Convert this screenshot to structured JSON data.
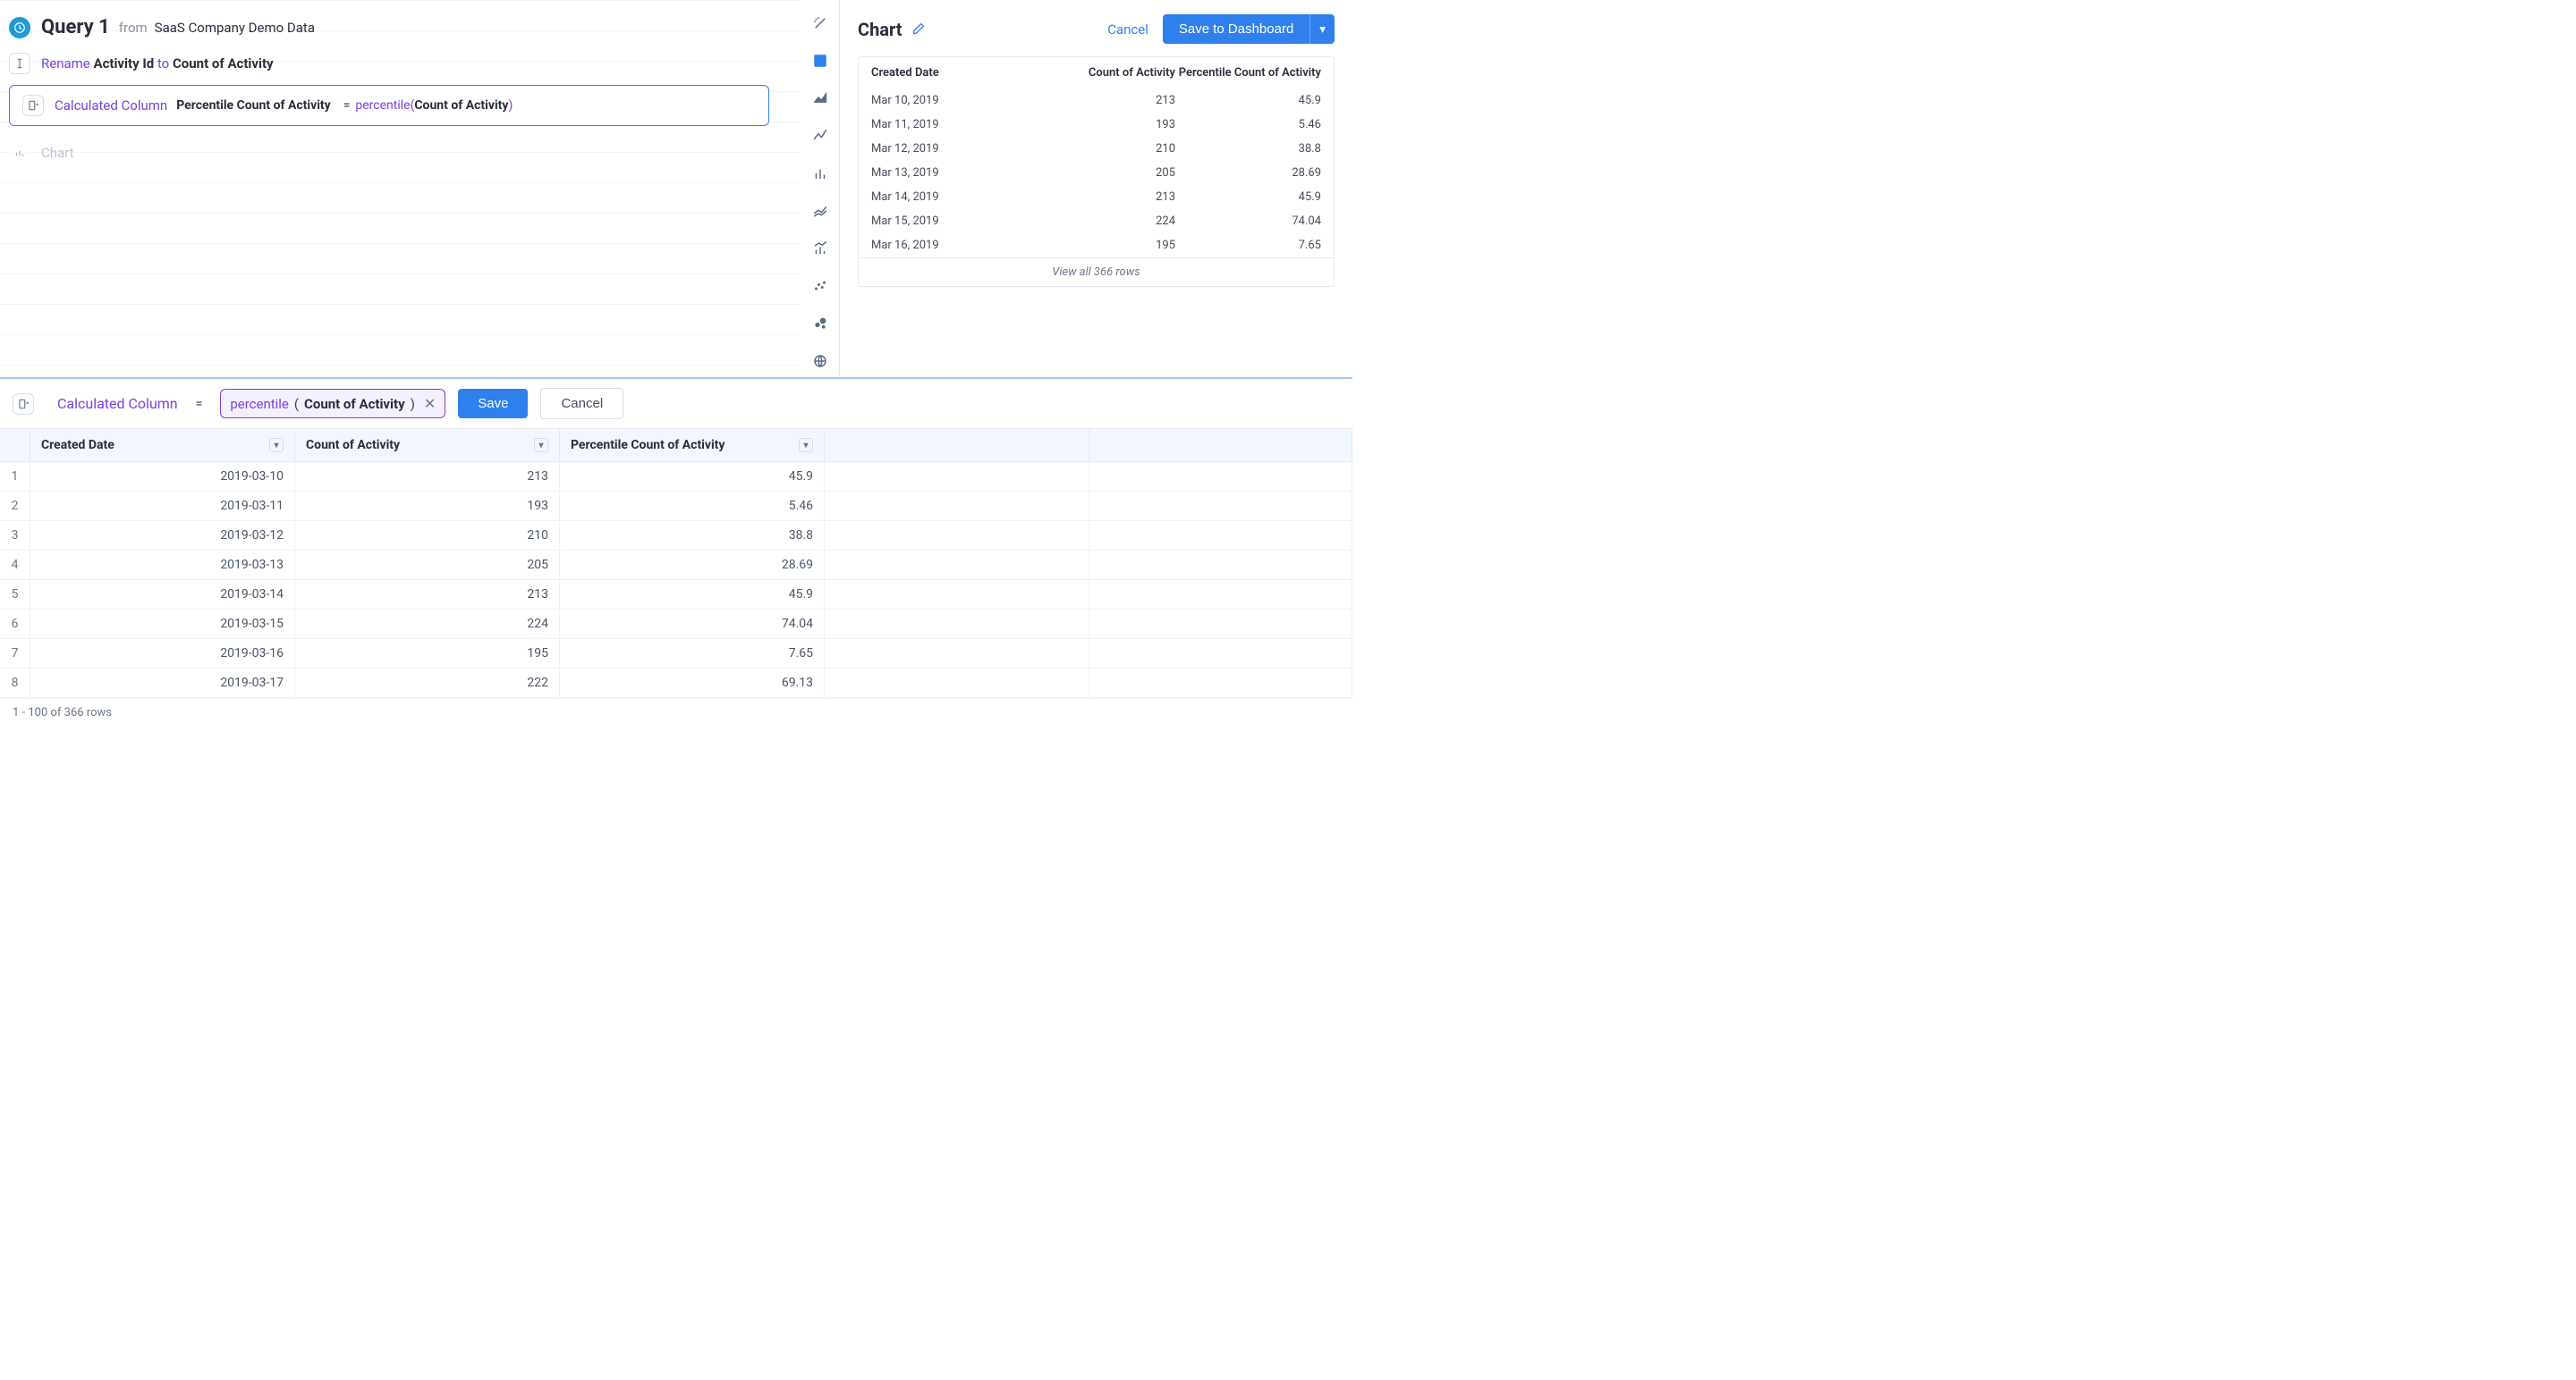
{
  "query": {
    "title": "Query 1",
    "from_label": "from",
    "source": "SaaS Company Demo Data"
  },
  "steps": {
    "rename": {
      "prefix": "Rename",
      "old": "Activity Id",
      "to": "to",
      "new": "Count of Activity"
    },
    "calc": {
      "label": "Calculated Column",
      "column": "Percentile Count of Activity",
      "equals": "=",
      "fn": "percentile",
      "arg": "Count of Activity"
    },
    "chart_placeholder": "Chart"
  },
  "chart_panel": {
    "title": "Chart",
    "cancel": "Cancel",
    "save": "Save to Dashboard",
    "preview_headers": {
      "c1": "Created Date",
      "c2": "Count of Activity",
      "c3": "Percentile Count of Activity"
    },
    "view_all": "View all 366 rows",
    "rows": [
      {
        "date": "Mar 10, 2019",
        "count": "213",
        "pct": "45.9"
      },
      {
        "date": "Mar 11, 2019",
        "count": "193",
        "pct": "5.46"
      },
      {
        "date": "Mar 12, 2019",
        "count": "210",
        "pct": "38.8"
      },
      {
        "date": "Mar 13, 2019",
        "count": "205",
        "pct": "28.69"
      },
      {
        "date": "Mar 14, 2019",
        "count": "213",
        "pct": "45.9"
      },
      {
        "date": "Mar 15, 2019",
        "count": "224",
        "pct": "74.04"
      },
      {
        "date": "Mar 16, 2019",
        "count": "195",
        "pct": "7.65"
      }
    ]
  },
  "editor": {
    "label": "Calculated Column",
    "equals": "=",
    "fn": "percentile",
    "arg": "Count of Activity",
    "save": "Save",
    "cancel": "Cancel"
  },
  "table": {
    "headers": {
      "c1": "Created Date",
      "c2": "Count of Activity",
      "c3": "Percentile Count of Activity"
    },
    "rows": [
      {
        "i": "1",
        "date": "2019-03-10",
        "count": "213",
        "pct": "45.9"
      },
      {
        "i": "2",
        "date": "2019-03-11",
        "count": "193",
        "pct": "5.46"
      },
      {
        "i": "3",
        "date": "2019-03-12",
        "count": "210",
        "pct": "38.8"
      },
      {
        "i": "4",
        "date": "2019-03-13",
        "count": "205",
        "pct": "28.69"
      },
      {
        "i": "5",
        "date": "2019-03-14",
        "count": "213",
        "pct": "45.9"
      },
      {
        "i": "6",
        "date": "2019-03-15",
        "count": "224",
        "pct": "74.04"
      },
      {
        "i": "7",
        "date": "2019-03-16",
        "count": "195",
        "pct": "7.65"
      },
      {
        "i": "8",
        "date": "2019-03-17",
        "count": "222",
        "pct": "69.13"
      }
    ],
    "footer": "1 - 100 of 366 rows"
  },
  "chart_data": {
    "type": "table",
    "columns": [
      "Created Date",
      "Count of Activity",
      "Percentile Count of Activity"
    ],
    "rows": [
      [
        "2019-03-10",
        213,
        45.9
      ],
      [
        "2019-03-11",
        193,
        5.46
      ],
      [
        "2019-03-12",
        210,
        38.8
      ],
      [
        "2019-03-13",
        205,
        28.69
      ],
      [
        "2019-03-14",
        213,
        45.9
      ],
      [
        "2019-03-15",
        224,
        74.04
      ],
      [
        "2019-03-16",
        195,
        7.65
      ],
      [
        "2019-03-17",
        222,
        69.13
      ]
    ],
    "total_rows": 366
  }
}
